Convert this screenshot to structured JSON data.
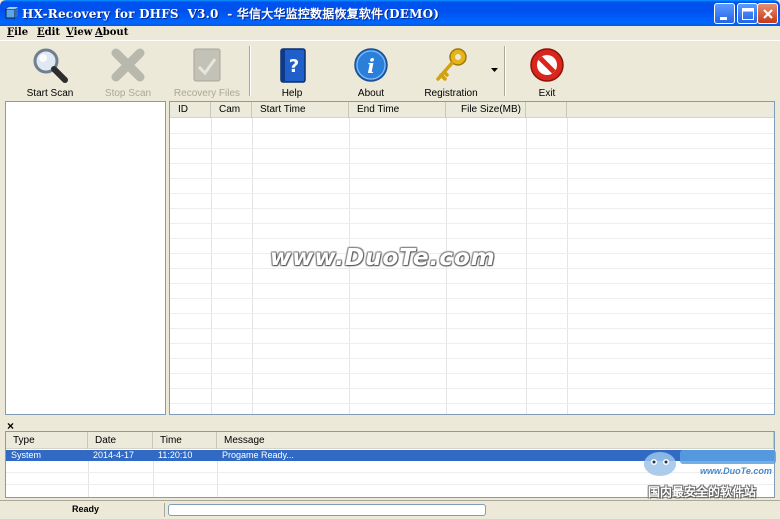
{
  "window": {
    "title": "HX-Recovery for DHFS  V3.0  - 华信大华监控数据恢复软件(DEMO)"
  },
  "menu": [
    "File",
    "Edit",
    "View",
    "About"
  ],
  "toolbar": {
    "start_scan": "Start Scan",
    "stop_scan": "Stop Scan",
    "recovery_files": "Recovery Files",
    "help": "Help",
    "about": "About",
    "registration": "Registration",
    "exit": "Exit"
  },
  "grid": {
    "columns": [
      "ID",
      "Cam",
      "Start Time",
      "End Time",
      "File Size(MB)",
      ""
    ],
    "rows": []
  },
  "watermark": "www.DuoTe.com",
  "log": {
    "close_glyph": "×",
    "columns": [
      "Type",
      "Date",
      "Time",
      "Message"
    ],
    "rows": [
      {
        "type": "System",
        "date": "2014-4-17",
        "time": "11:20:10",
        "message": "Progame Ready..."
      }
    ]
  },
  "status": {
    "text": "Ready",
    "progress": 0
  },
  "corner_logo": {
    "url": "www.DuoTe.com",
    "caption": "国内最安全的软件站"
  },
  "colors": {
    "titlebar": "#0053ee",
    "selection": "#316ac5",
    "exit_red": "#d9261c",
    "help_blue": "#1e5fc9",
    "about_blue": "#2b7fd8",
    "key_gold": "#e7b418"
  },
  "icons": {
    "start_scan": "magnifier-icon",
    "stop_scan": "x-cross-icon",
    "recovery_files": "file-recovery-icon",
    "help": "help-book-icon",
    "about": "info-icon",
    "registration": "key-icon",
    "exit": "no-entry-icon"
  }
}
